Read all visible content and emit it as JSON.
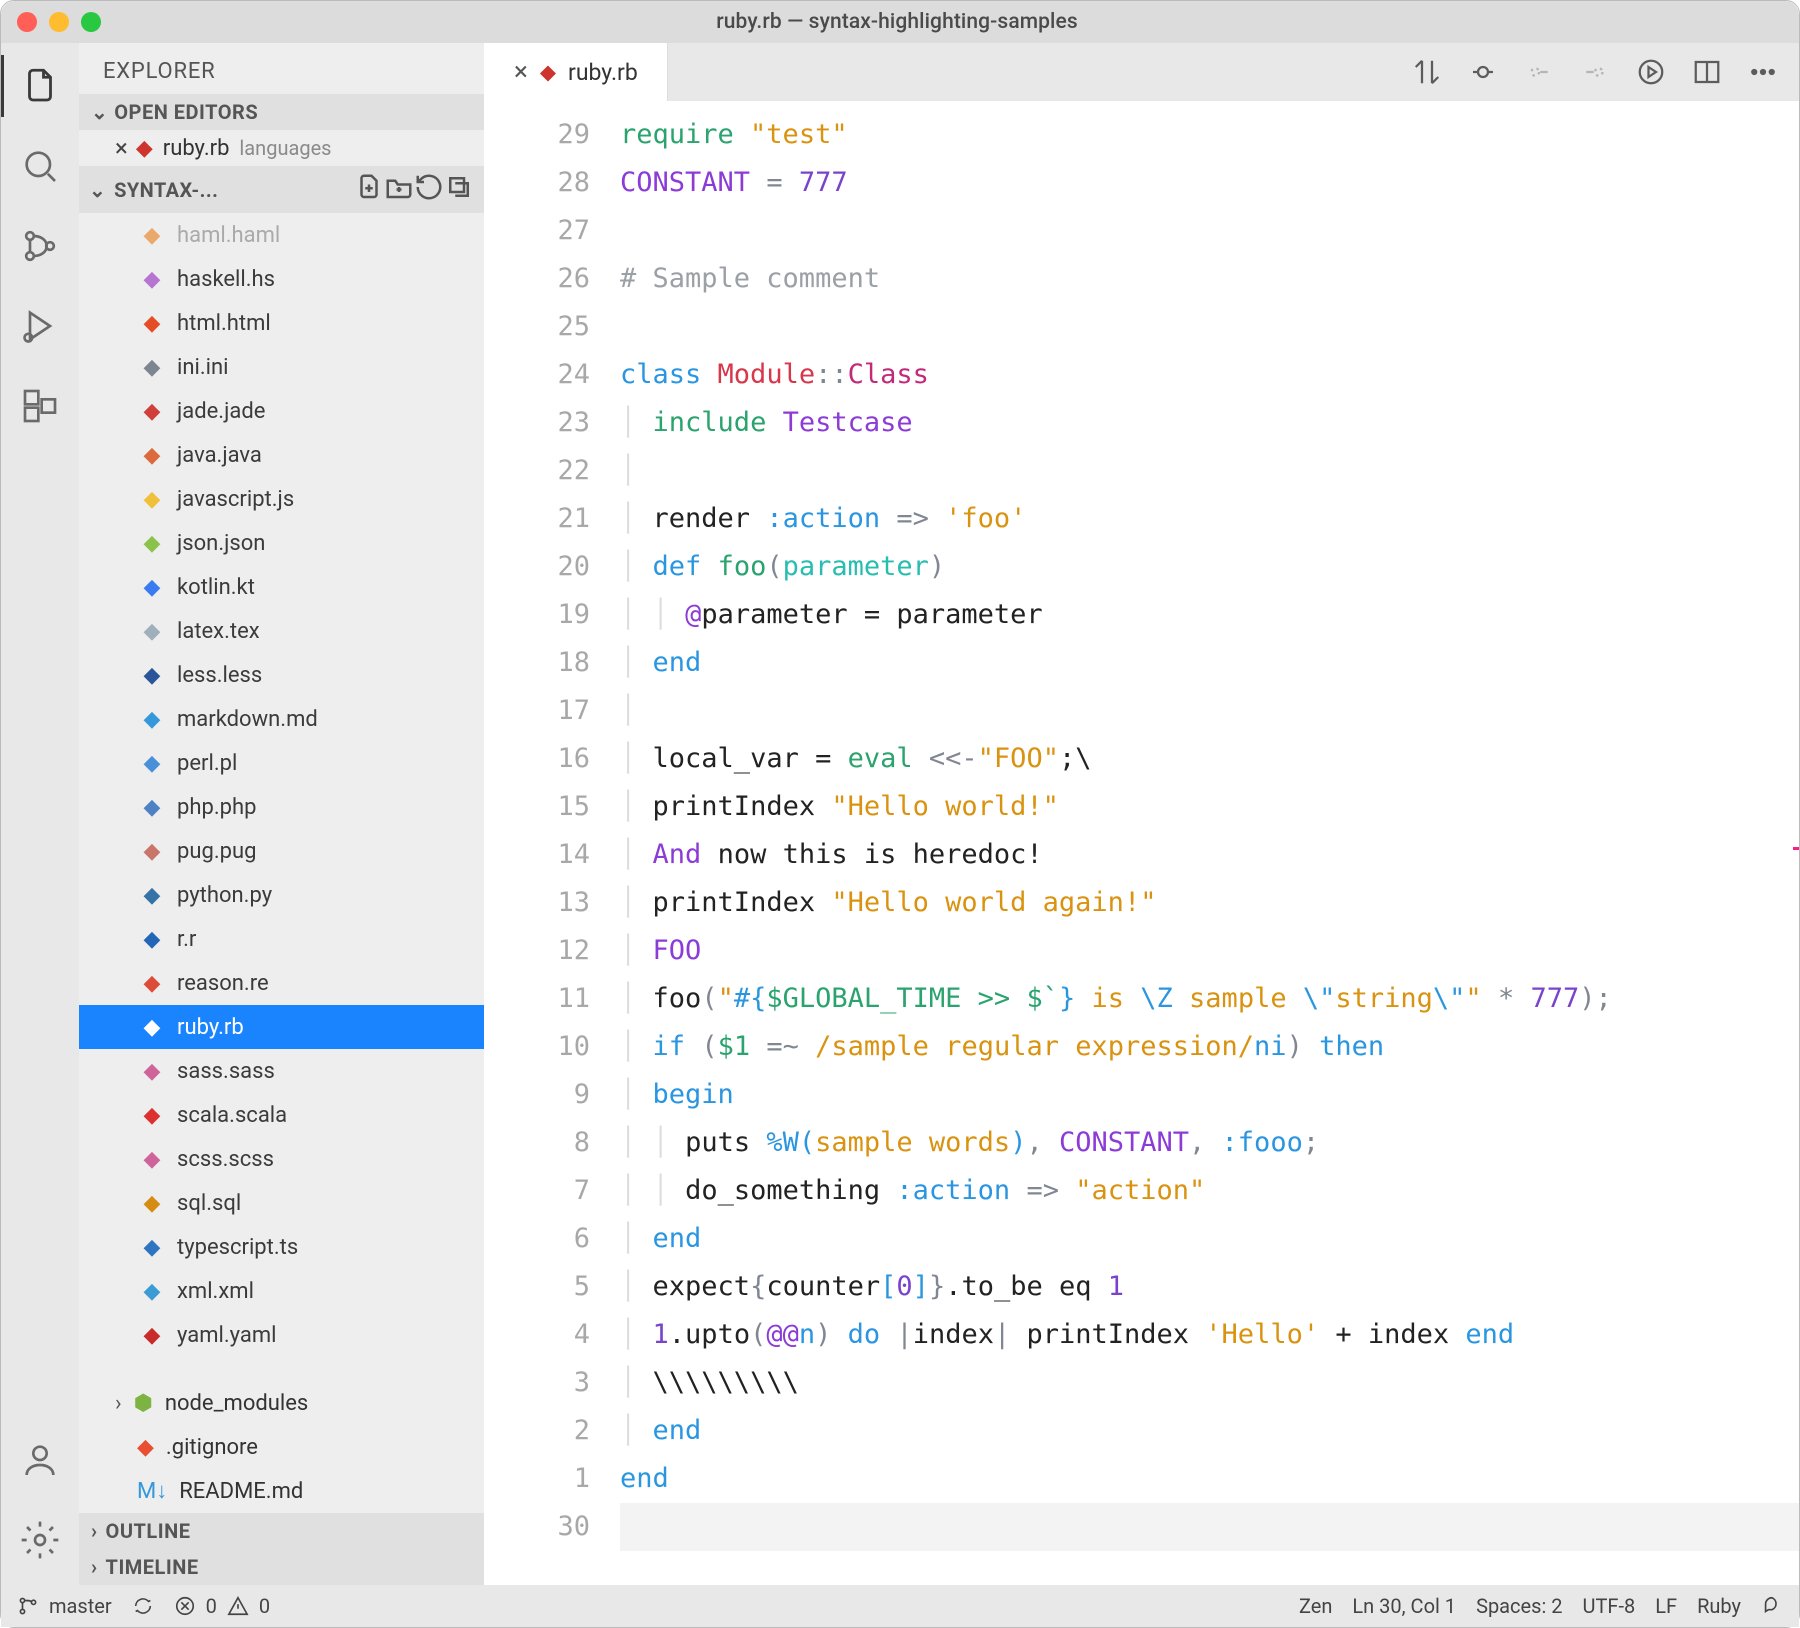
{
  "titlebar": {
    "title": "ruby.rb — syntax-highlighting-samples"
  },
  "sidebar": {
    "header": "EXPLORER",
    "open_editors_label": "OPEN EDITORS",
    "open_editor_file": "ruby.rb",
    "open_editor_dim": "languages",
    "folder_label": "SYNTAX-...",
    "tree": [
      {
        "name": "haml.haml",
        "icon": "haml",
        "dim": true
      },
      {
        "name": "haskell.hs",
        "icon": "hs"
      },
      {
        "name": "html.html",
        "icon": "html"
      },
      {
        "name": "ini.ini",
        "icon": "ini"
      },
      {
        "name": "jade.jade",
        "icon": "jade"
      },
      {
        "name": "java.java",
        "icon": "java"
      },
      {
        "name": "javascript.js",
        "icon": "js"
      },
      {
        "name": "json.json",
        "icon": "json"
      },
      {
        "name": "kotlin.kt",
        "icon": "kt"
      },
      {
        "name": "latex.tex",
        "icon": "tex"
      },
      {
        "name": "less.less",
        "icon": "less"
      },
      {
        "name": "markdown.md",
        "icon": "md"
      },
      {
        "name": "perl.pl",
        "icon": "pl"
      },
      {
        "name": "php.php",
        "icon": "php"
      },
      {
        "name": "pug.pug",
        "icon": "pug"
      },
      {
        "name": "python.py",
        "icon": "py"
      },
      {
        "name": "r.r",
        "icon": "r"
      },
      {
        "name": "reason.re",
        "icon": "re"
      },
      {
        "name": "ruby.rb",
        "icon": "rb",
        "sel": true
      },
      {
        "name": "sass.sass",
        "icon": "sass"
      },
      {
        "name": "scala.scala",
        "icon": "scala"
      },
      {
        "name": "scss.scss",
        "icon": "scss"
      },
      {
        "name": "sql.sql",
        "icon": "sql"
      },
      {
        "name": "typescript.ts",
        "icon": "ts"
      },
      {
        "name": "xml.xml",
        "icon": "xml"
      },
      {
        "name": "yaml.yaml",
        "icon": "yaml"
      }
    ],
    "node_modules": "node_modules",
    "gitignore": ".gitignore",
    "readme": "README.md",
    "outline_label": "OUTLINE",
    "timeline_label": "TIMELINE"
  },
  "tab": {
    "label": "ruby.rb"
  },
  "code": {
    "gutter": [
      "29",
      "28",
      "27",
      "26",
      "25",
      "24",
      "23",
      "22",
      "21",
      "20",
      "19",
      "18",
      "17",
      "16",
      "15",
      "14",
      "13",
      "12",
      "11",
      "10",
      "9",
      "8",
      "7",
      "6",
      "5",
      "4",
      "3",
      "2",
      "1",
      "30"
    ],
    "lines": [
      [
        {
          "t": "require ",
          "c": "grn"
        },
        {
          "t": "\"test\"",
          "c": "str"
        }
      ],
      [
        {
          "t": "CONSTANT ",
          "c": "pur"
        },
        {
          "t": "= ",
          "c": "sym"
        },
        {
          "t": "777",
          "c": "num"
        }
      ],
      [],
      [
        {
          "t": "# Sample comment",
          "c": "com"
        }
      ],
      [],
      [
        {
          "t": "class ",
          "c": "kw"
        },
        {
          "t": "Module",
          "c": "red"
        },
        {
          "t": "::",
          "c": "sym"
        },
        {
          "t": "Class",
          "c": "mag"
        }
      ],
      [
        {
          "g": 1
        },
        {
          "t": "include ",
          "c": "grn"
        },
        {
          "t": "Testcase",
          "c": "pur"
        }
      ],
      [
        {
          "g": 1
        }
      ],
      [
        {
          "g": 1
        },
        {
          "t": "render ",
          "c": "lv"
        },
        {
          "t": ":action ",
          "c": "kw"
        },
        {
          "t": "=> ",
          "c": "sym"
        },
        {
          "t": "'foo'",
          "c": "str"
        }
      ],
      [
        {
          "g": 1
        },
        {
          "t": "def ",
          "c": "kw"
        },
        {
          "t": "foo",
          "c": "grn"
        },
        {
          "t": "(",
          "c": "sym"
        },
        {
          "t": "parameter",
          "c": "cy"
        },
        {
          "t": ")",
          "c": "sym"
        }
      ],
      [
        {
          "g": 2
        },
        {
          "t": "@",
          "c": "pur"
        },
        {
          "t": "parameter = parameter",
          "c": "lv"
        }
      ],
      [
        {
          "g": 1
        },
        {
          "t": "end",
          "c": "kw"
        }
      ],
      [
        {
          "g": 1
        }
      ],
      [
        {
          "g": 1
        },
        {
          "t": "local_var = ",
          "c": "lv"
        },
        {
          "t": "eval ",
          "c": "grn"
        },
        {
          "t": "<<-",
          "c": "sym"
        },
        {
          "t": "\"FOO\"",
          "c": "str"
        },
        {
          "t": ";\\",
          "c": "lv"
        }
      ],
      [
        {
          "g": 1
        },
        {
          "t": "printIndex ",
          "c": "lv"
        },
        {
          "t": "\"Hello world!\"",
          "c": "str"
        }
      ],
      [
        {
          "g": 1
        },
        {
          "t": "And ",
          "c": "pur"
        },
        {
          "t": "now this is heredoc!",
          "c": "lv"
        }
      ],
      [
        {
          "g": 1
        },
        {
          "t": "printIndex ",
          "c": "lv"
        },
        {
          "t": "\"Hello world again!\"",
          "c": "str"
        }
      ],
      [
        {
          "g": 1
        },
        {
          "t": "FOO",
          "c": "pur"
        }
      ],
      [
        {
          "g": 1
        },
        {
          "t": "foo",
          "c": "lv"
        },
        {
          "t": "(",
          "c": "sym"
        },
        {
          "t": "\"",
          "c": "str"
        },
        {
          "t": "#{",
          "c": "kw"
        },
        {
          "t": "$GLOBAL_TIME >> $`",
          "c": "grn"
        },
        {
          "t": "}",
          "c": "kw"
        },
        {
          "t": " is ",
          "c": "str"
        },
        {
          "t": "\\Z ",
          "c": "kw"
        },
        {
          "t": "sample ",
          "c": "str"
        },
        {
          "t": "\\\"",
          "c": "kw"
        },
        {
          "t": "string",
          "c": "str"
        },
        {
          "t": "\\\"",
          "c": "kw"
        },
        {
          "t": "\"",
          "c": "str"
        },
        {
          "t": " * ",
          "c": "sym"
        },
        {
          "t": "777",
          "c": "num"
        },
        {
          "t": ");",
          "c": "sym"
        }
      ],
      [
        {
          "g": 1
        },
        {
          "t": "if ",
          "c": "kw"
        },
        {
          "t": "(",
          "c": "sym"
        },
        {
          "t": "$1 ",
          "c": "grn"
        },
        {
          "t": "=~ ",
          "c": "sym"
        },
        {
          "t": "/sample regular expression/",
          "c": "str"
        },
        {
          "t": "ni",
          "c": "kw"
        },
        {
          "t": ") ",
          "c": "sym"
        },
        {
          "t": "then",
          "c": "kw"
        }
      ],
      [
        {
          "g": 1
        },
        {
          "t": "begin",
          "c": "kw"
        }
      ],
      [
        {
          "g": 2
        },
        {
          "t": "puts ",
          "c": "lv"
        },
        {
          "t": "%W(",
          "c": "kw"
        },
        {
          "t": "sample words",
          "c": "str"
        },
        {
          "t": ")",
          "c": "kw"
        },
        {
          "t": ", ",
          "c": "sym"
        },
        {
          "t": "CONSTANT",
          "c": "pur"
        },
        {
          "t": ", ",
          "c": "sym"
        },
        {
          "t": ":fooo",
          "c": "kw"
        },
        {
          "t": ";",
          "c": "sym"
        }
      ],
      [
        {
          "g": 2
        },
        {
          "t": "do_something ",
          "c": "lv"
        },
        {
          "t": ":action ",
          "c": "kw"
        },
        {
          "t": "=> ",
          "c": "sym"
        },
        {
          "t": "\"action\"",
          "c": "str"
        }
      ],
      [
        {
          "g": 1
        },
        {
          "t": "end",
          "c": "kw"
        }
      ],
      [
        {
          "g": 1
        },
        {
          "t": "expect",
          "c": "lv"
        },
        {
          "t": "{",
          "c": "sym"
        },
        {
          "t": "counter",
          "c": "lv"
        },
        {
          "t": "[",
          "c": "kw"
        },
        {
          "t": "0",
          "c": "num"
        },
        {
          "t": "]",
          "c": "kw"
        },
        {
          "t": "}",
          "c": "sym"
        },
        {
          "t": ".to_be eq ",
          "c": "lv"
        },
        {
          "t": "1",
          "c": "num"
        }
      ],
      [
        {
          "g": 1
        },
        {
          "t": "1",
          "c": "num"
        },
        {
          "t": ".upto",
          "c": "lv"
        },
        {
          "t": "(",
          "c": "sym"
        },
        {
          "t": "@@",
          "c": "pur"
        },
        {
          "t": "n",
          "c": "kw"
        },
        {
          "t": ") ",
          "c": "sym"
        },
        {
          "t": "do ",
          "c": "kw"
        },
        {
          "t": "|",
          "c": "sym"
        },
        {
          "t": "index",
          "c": "lv"
        },
        {
          "t": "| ",
          "c": "sym"
        },
        {
          "t": "printIndex ",
          "c": "lv"
        },
        {
          "t": "'Hello'",
          "c": "str"
        },
        {
          "t": " + index ",
          "c": "lv"
        },
        {
          "t": "end",
          "c": "kw"
        }
      ],
      [
        {
          "g": 1
        },
        {
          "t": "\\\\\\\\\\\\\\\\\\",
          "c": "lv"
        }
      ],
      [
        {
          "g": 1
        },
        {
          "t": "end",
          "c": "kw"
        }
      ],
      [
        {
          "t": "end",
          "c": "kw"
        }
      ],
      [
        {
          "cur": true
        }
      ]
    ]
  },
  "status": {
    "branch": "master",
    "errors": "0",
    "warnings": "0",
    "zen": "Zen",
    "cursor": "",
    "cursor2": "30, Col 1",
    "lncol": "Ln 30, Col 1",
    "spaces": "Spaces: 2",
    "encoding": "UTF-8",
    "eol": "LF",
    "language": "Ruby"
  }
}
